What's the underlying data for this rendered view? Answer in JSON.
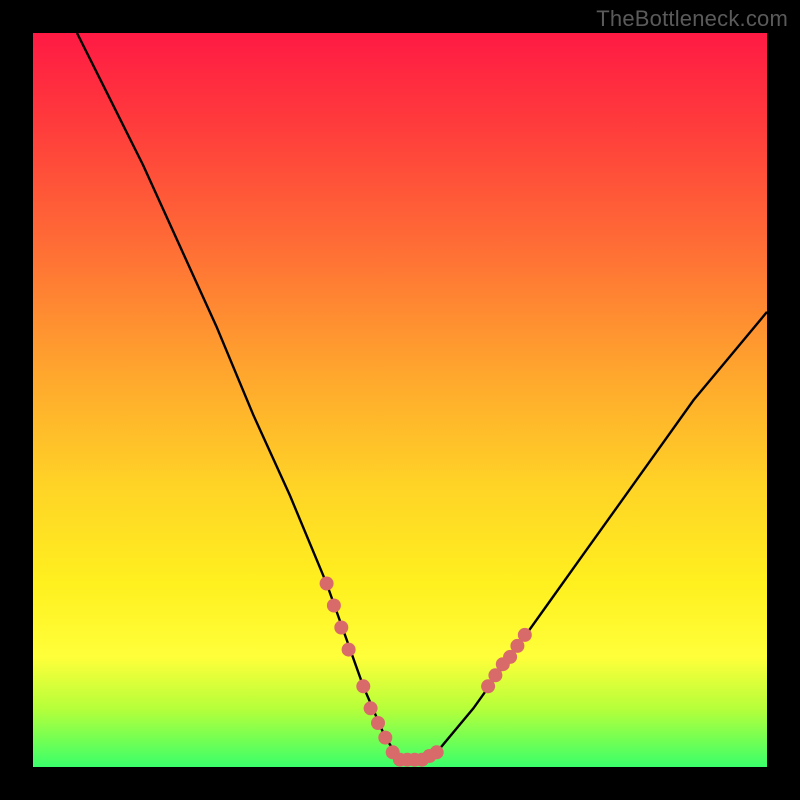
{
  "watermark": "TheBottleneck.com",
  "chart_data": {
    "type": "line",
    "title": "",
    "xlabel": "",
    "ylabel": "",
    "xlim": [
      0,
      100
    ],
    "ylim": [
      0,
      100
    ],
    "series": [
      {
        "name": "bottleneck-curve",
        "x": [
          6,
          10,
          15,
          20,
          25,
          30,
          35,
          40,
          45,
          48,
          50,
          52,
          55,
          60,
          65,
          70,
          75,
          80,
          85,
          90,
          95,
          100
        ],
        "y": [
          100,
          92,
          82,
          71,
          60,
          48,
          37,
          25,
          11,
          4,
          1,
          1,
          2,
          8,
          15,
          22,
          29,
          36,
          43,
          50,
          56,
          62
        ]
      }
    ],
    "markers": {
      "name": "highlight-dots",
      "points": [
        {
          "x": 40,
          "y": 25
        },
        {
          "x": 41,
          "y": 22
        },
        {
          "x": 42,
          "y": 19
        },
        {
          "x": 43,
          "y": 16
        },
        {
          "x": 45,
          "y": 11
        },
        {
          "x": 46,
          "y": 8
        },
        {
          "x": 47,
          "y": 6
        },
        {
          "x": 48,
          "y": 4
        },
        {
          "x": 49,
          "y": 2
        },
        {
          "x": 50,
          "y": 1
        },
        {
          "x": 51,
          "y": 1
        },
        {
          "x": 52,
          "y": 1
        },
        {
          "x": 53,
          "y": 1
        },
        {
          "x": 54,
          "y": 1.5
        },
        {
          "x": 55,
          "y": 2
        },
        {
          "x": 62,
          "y": 11
        },
        {
          "x": 63,
          "y": 12.5
        },
        {
          "x": 64,
          "y": 14
        },
        {
          "x": 65,
          "y": 15
        },
        {
          "x": 66,
          "y": 16.5
        },
        {
          "x": 67,
          "y": 18
        }
      ]
    },
    "colors": {
      "curve": "#000000",
      "markers": "#d96a6a",
      "gradient_top": "#ff1a44",
      "gradient_bottom": "#3aff6a"
    }
  }
}
